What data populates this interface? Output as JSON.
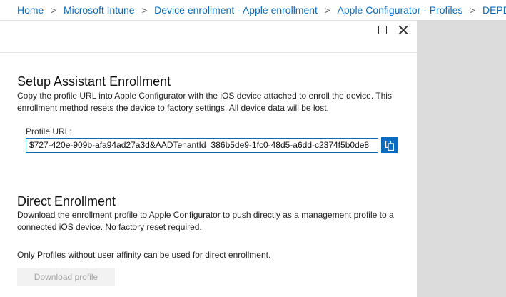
{
  "breadcrumb": {
    "items": [
      "Home",
      "Microsoft Intune",
      "Device enrollment - Apple enrollment",
      "Apple Configurator - Profiles",
      "DEPDevices"
    ],
    "separator": ">"
  },
  "setup_assistant": {
    "title": "Setup Assistant Enrollment",
    "description": "Copy the profile URL into Apple Configurator with the iOS device attached to enroll the device. This enrollment method resets the device to factory settings. All device data will be lost.",
    "profile_url_label": "Profile URL:",
    "profile_url_value": "$727-420e-909b-afa94ad27a3d&AADTenantId=386b5de9-1fc0-48d5-a6dd-c2374f5b0de8"
  },
  "direct_enrollment": {
    "title": "Direct Enrollment",
    "description": "Download the enrollment profile to Apple Configurator to push directly as a management profile to a connected iOS device. No factory reset required.",
    "note": "Only Profiles without user affinity can be used for direct enrollment.",
    "download_button_label": "Download profile"
  },
  "colors": {
    "accent": "#0b6cbd",
    "side_panel": "#dcdcdc"
  }
}
